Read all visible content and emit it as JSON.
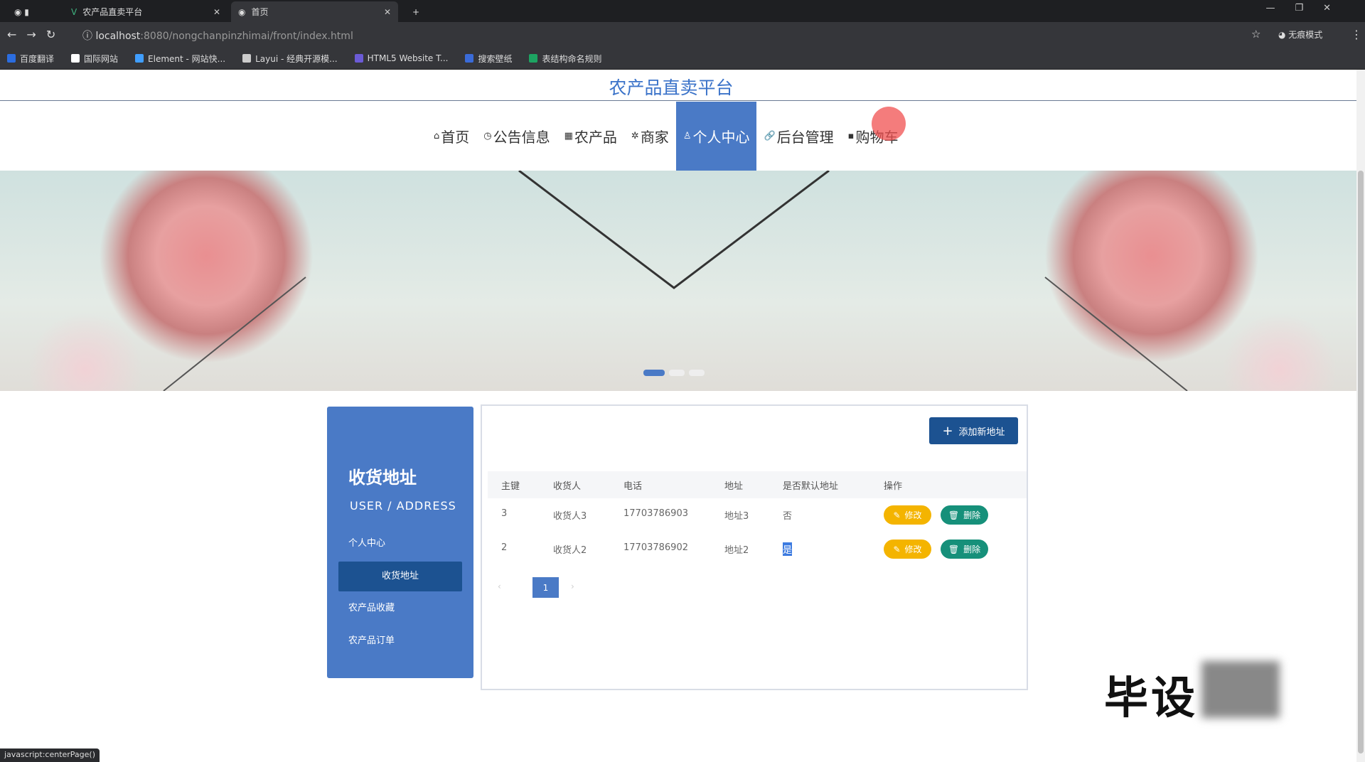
{
  "browser": {
    "tabs": [
      {
        "label": "农产品直卖平台"
      },
      {
        "label": "首页"
      }
    ],
    "url_host": "localhost",
    "url_rest": ":8080/nongchanpinzhimai/front/index.html",
    "profile": "无痕模式",
    "bookmarks": [
      {
        "label": "百度翻译",
        "color": "#2b6de0"
      },
      {
        "label": "国际网站",
        "color": "#ffffff"
      },
      {
        "label": "Element - 网站快...",
        "color": "#409eff"
      },
      {
        "label": "Layui - 经典开源模...",
        "color": "#cccccc"
      },
      {
        "label": "HTML5 Website T...",
        "color": "#6b5bd6"
      },
      {
        "label": "搜索壁纸",
        "color": "#3a6bd8"
      },
      {
        "label": "表结构命名规则",
        "color": "#1da462"
      }
    ],
    "status": "javascript:centerPage()"
  },
  "header": {
    "title": "农产品直卖平台"
  },
  "nav": [
    {
      "icon": "home-icon",
      "glyph": "⌂",
      "label": "首页"
    },
    {
      "icon": "clock-icon",
      "glyph": "◷",
      "label": "公告信息"
    },
    {
      "icon": "grid-icon",
      "glyph": "▦",
      "label": "农产品"
    },
    {
      "icon": "shop-icon",
      "glyph": "✲",
      "label": "商家"
    },
    {
      "icon": "user-icon",
      "glyph": "♙",
      "label": "个人中心",
      "active": true
    },
    {
      "icon": "link-icon",
      "glyph": "🔗",
      "label": "后台管理"
    },
    {
      "icon": "cart-icon",
      "glyph": "▪",
      "label": "购物车"
    }
  ],
  "sidebar": {
    "title": "收货地址",
    "subtitle": "USER / ADDRESS",
    "items": [
      {
        "label": "个人中心"
      },
      {
        "label": "收货地址",
        "active": true
      },
      {
        "label": "农产品收藏"
      },
      {
        "label": "农产品订单"
      }
    ]
  },
  "content": {
    "add_button": "添加新地址",
    "columns": [
      "主键",
      "收货人",
      "电话",
      "地址",
      "是否默认地址",
      "操作"
    ],
    "rows": [
      {
        "id": "3",
        "name": "收货人3",
        "phone": "17703786903",
        "address": "地址3",
        "default": "否"
      },
      {
        "id": "2",
        "name": "收货人2",
        "phone": "17703786902",
        "address": "地址2",
        "default": "是"
      }
    ],
    "edit_label": "修改",
    "delete_label": "删除",
    "page": "1"
  },
  "watermark": "毕设",
  "colors": {
    "accent": "#4a7ac6",
    "dark": "#1c5291",
    "edit": "#f4b400",
    "delete": "#16907a"
  }
}
